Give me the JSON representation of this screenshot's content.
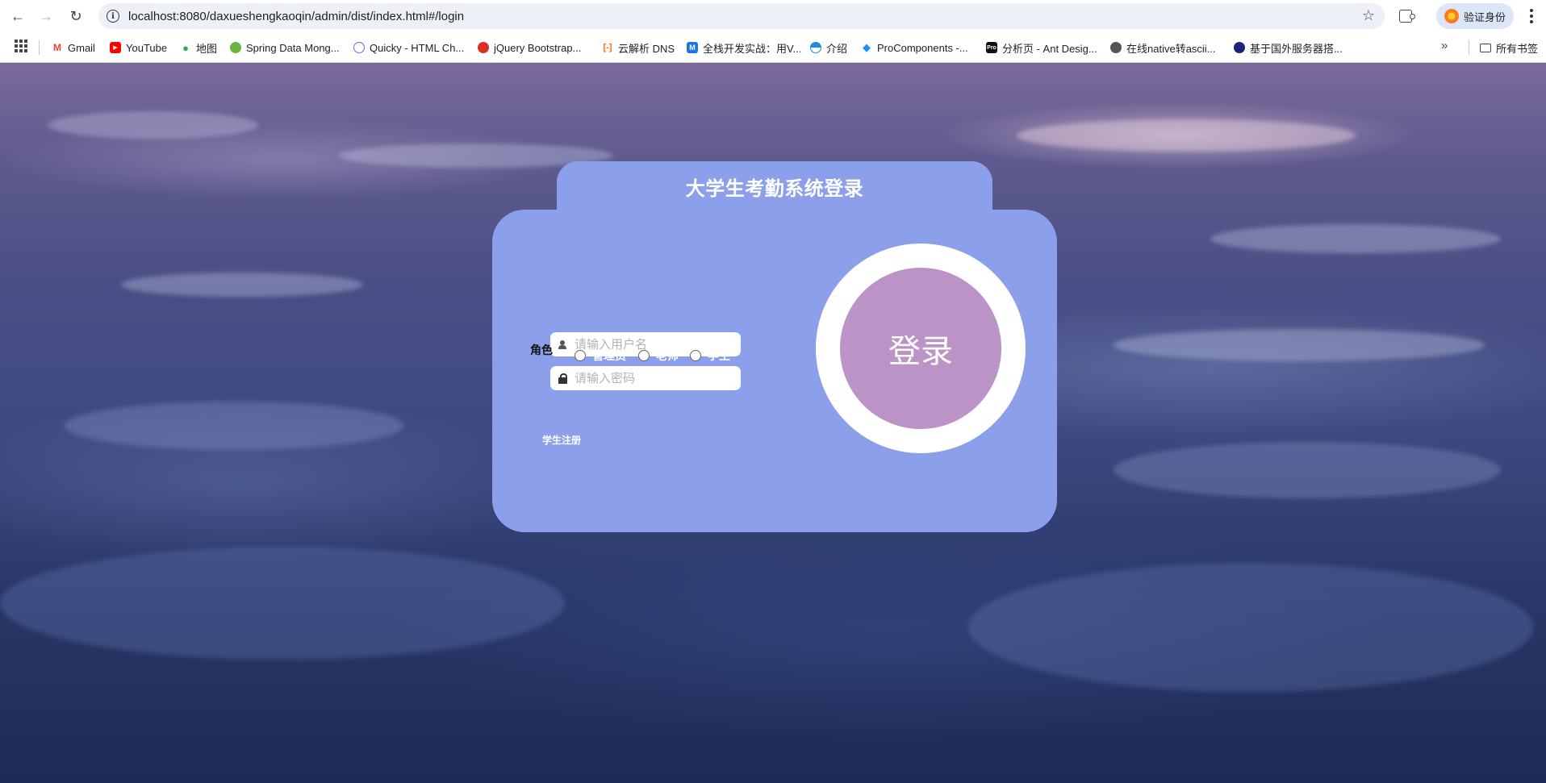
{
  "browser": {
    "url": "localhost:8080/daxueshengkaoqin/admin/dist/index.html#/login",
    "profile_label": "验证身份",
    "bookmarks": [
      {
        "label": "Gmail",
        "icon": "gmail-icon",
        "color": "#ea4335"
      },
      {
        "label": "YouTube",
        "icon": "youtube-icon",
        "color": "#ff0000"
      },
      {
        "label": "地图",
        "icon": "maps-pin-icon",
        "color": "#34a853"
      },
      {
        "label": "Spring Data Mong...",
        "icon": "spring-icon",
        "color": "#6db33f"
      },
      {
        "label": "Quicky - HTML Ch...",
        "icon": "quicky-icon",
        "color": "#5b6ee1"
      },
      {
        "label": "jQuery Bootstrap...",
        "icon": "jquery-icon",
        "color": "#d93025"
      },
      {
        "label": "云解析 DNS",
        "icon": "cloud-dns-icon",
        "color": "#ff6a00"
      },
      {
        "label": "全栈开发实战：用V...",
        "icon": "m-icon",
        "color": "#1a73e8"
      },
      {
        "label": "介绍",
        "icon": "intro-icon",
        "color": "#1e88e5"
      },
      {
        "label": "ProComponents -...",
        "icon": "procomponents-icon",
        "color": "#1890ff"
      },
      {
        "label": "分析页 - Ant Desig...",
        "icon": "pro-icon",
        "color": "#111111"
      },
      {
        "label": "在线native转ascii...",
        "icon": "globe-icon",
        "color": "#555555"
      },
      {
        "label": "基于国外服务器搭...",
        "icon": "server-icon",
        "color": "#1a237e"
      }
    ],
    "bookmarks_folder": "所有书签"
  },
  "login": {
    "title": "大学生考勤系统登录",
    "username_placeholder": "请输入用户名",
    "password_placeholder": "请输入密码",
    "role_label": "角色",
    "roles": [
      "管理员",
      "老师",
      "学生"
    ],
    "register_link": "学生注册",
    "login_button": "登录"
  },
  "colors": {
    "card": "#8c9feb",
    "login_button": "#bb93c7"
  }
}
